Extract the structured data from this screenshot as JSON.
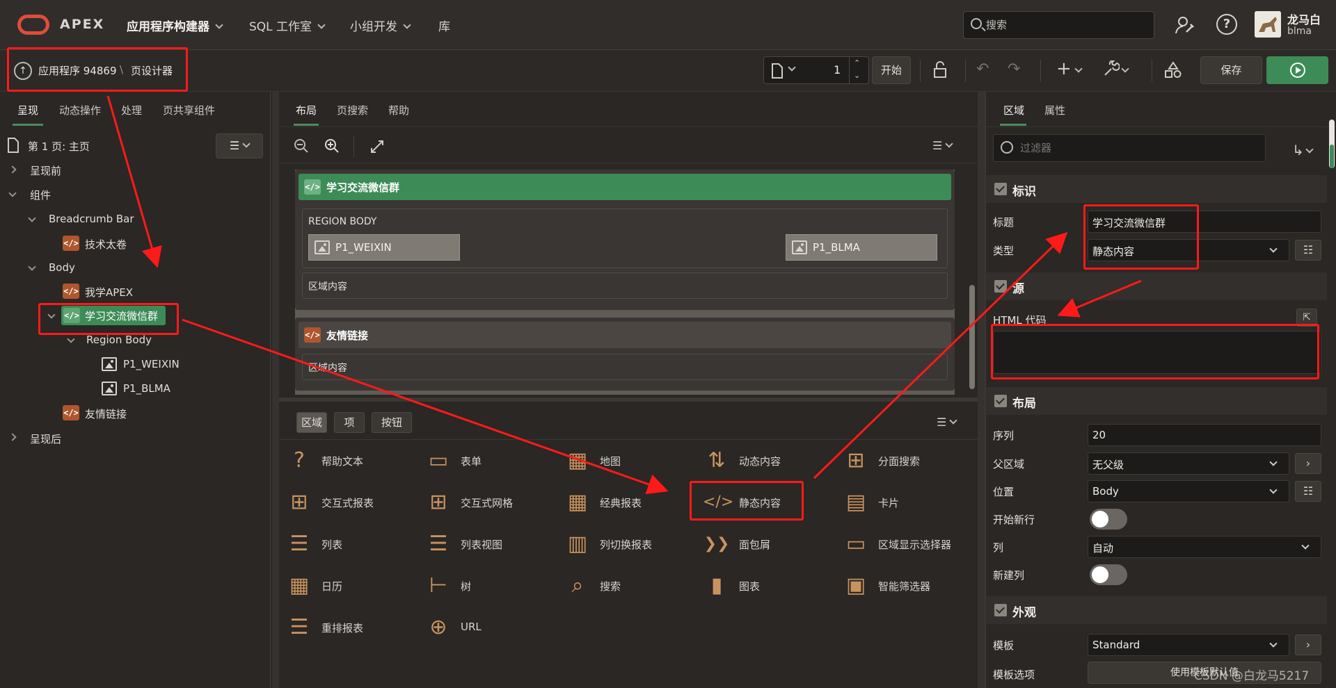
{
  "brand": {
    "name": "APEX",
    "logo_color": "#e04c3c"
  },
  "nav": {
    "app_builder": "应用程序构建器",
    "sql_workshop": "SQL 工作室",
    "team_dev": "小组开发",
    "gallery": "库"
  },
  "search": {
    "placeholder": "搜索"
  },
  "user": {
    "display_name": "龙马白",
    "id": "blma"
  },
  "breadcrumb": {
    "app": "应用程序 94869",
    "separator": "\\",
    "page": "页设计器"
  },
  "toolbar": {
    "page_number": "1",
    "go_label": "开始",
    "save_label": "保存",
    "plus_glyph": "+"
  },
  "left": {
    "tabs": [
      "呈现",
      "动态操作",
      "处理",
      "页共享组件"
    ],
    "page_title": "第 1 页: 主页",
    "tree": {
      "before": "呈现前",
      "components": "组件",
      "breadcrumb_bar": "Breadcrumb Bar",
      "tech_taijuan": "技术太卷",
      "body": "Body",
      "learn_apex": "我学APEX",
      "wechat_group": "学习交流微信群",
      "region_body": "Region Body",
      "p1_weixin": "P1_WEIXIN",
      "p1_blma": "P1_BLMA",
      "friend_links": "友情链接",
      "after": "呈现后"
    }
  },
  "middle": {
    "tabs": [
      "布局",
      "页搜索",
      "帮助"
    ],
    "region1": {
      "title": "学习交流微信群",
      "body_label": "REGION BODY",
      "item1": "P1_WEIXIN",
      "item2": "P1_BLMA",
      "content": "区域内容"
    },
    "region2": {
      "title": "友情链接",
      "content": "区域内容"
    },
    "gallery_tabs": [
      "区域",
      "项",
      "按钮"
    ],
    "gallery": [
      {
        "label": "帮助文本",
        "icon": "help-circle-icon",
        "glyph": "?"
      },
      {
        "label": "表单",
        "icon": "form-icon",
        "glyph": "▭"
      },
      {
        "label": "地图",
        "icon": "map-icon",
        "glyph": "▦"
      },
      {
        "label": "动态内容",
        "icon": "dynamic-content-icon",
        "glyph": "⇅"
      },
      {
        "label": "分面搜索",
        "icon": "faceted-search-icon",
        "glyph": "⊞"
      },
      {
        "label": "交互式报表",
        "icon": "interactive-report-icon",
        "glyph": "⊞"
      },
      {
        "label": "交互式网格",
        "icon": "interactive-grid-icon",
        "glyph": "⊞"
      },
      {
        "label": "经典报表",
        "icon": "classic-report-icon",
        "glyph": "▦"
      },
      {
        "label": "静态内容",
        "icon": "static-content-icon",
        "glyph": "</>"
      },
      {
        "label": "卡片",
        "icon": "cards-icon",
        "glyph": "▤"
      },
      {
        "label": "列表",
        "icon": "list-icon",
        "glyph": "☰"
      },
      {
        "label": "列表视图",
        "icon": "list-view-icon",
        "glyph": "☰"
      },
      {
        "label": "列切换报表",
        "icon": "column-toggle-icon",
        "glyph": "▥"
      },
      {
        "label": "面包屑",
        "icon": "breadcrumb-icon",
        "glyph": "❯❯"
      },
      {
        "label": "区域显示选择器",
        "icon": "region-selector-icon",
        "glyph": "▭"
      },
      {
        "label": "日历",
        "icon": "calendar-icon",
        "glyph": "▦"
      },
      {
        "label": "树",
        "icon": "tree-icon",
        "glyph": "⊢"
      },
      {
        "label": "搜索",
        "icon": "search-region-icon",
        "glyph": "⌕"
      },
      {
        "label": "图表",
        "icon": "chart-icon",
        "glyph": "▮"
      },
      {
        "label": "智能筛选器",
        "icon": "smart-filters-icon",
        "glyph": "▣"
      },
      {
        "label": "重排报表",
        "icon": "reflow-report-icon",
        "glyph": "☰"
      },
      {
        "label": "URL",
        "icon": "url-icon",
        "glyph": "⊕"
      }
    ]
  },
  "right": {
    "tabs": [
      "区域",
      "属性"
    ],
    "filter_placeholder": "过滤器",
    "identification": {
      "heading": "标识",
      "title_label": "标题",
      "title_value": "学习交流微信群",
      "type_label": "类型",
      "type_value": "静态内容"
    },
    "source": {
      "heading": "源",
      "html_label": "HTML 代码",
      "html_value": ""
    },
    "layout": {
      "heading": "布局",
      "seq_label": "序列",
      "seq_value": "20",
      "parent_label": "父区域",
      "parent_value": "无父级",
      "position_label": "位置",
      "position_value": "Body",
      "new_row_label": "开始新行",
      "column_label": "列",
      "column_value": "自动",
      "new_col_label": "新建列"
    },
    "appearance": {
      "heading": "外观",
      "template_label": "模板",
      "template_value": "Standard",
      "options_label": "模板选项",
      "options_value": "使用模板默认值"
    }
  },
  "watermark": "CSDN @白龙马5217",
  "annotation_color": "#ff1a1a"
}
